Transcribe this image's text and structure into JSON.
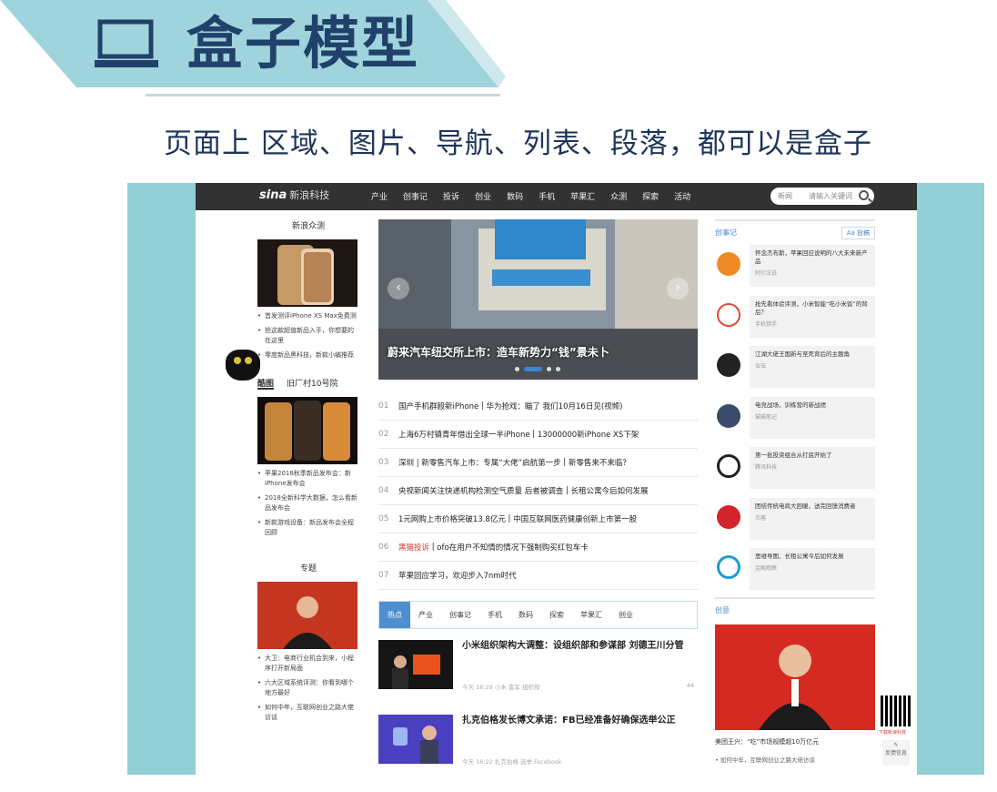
{
  "slide": {
    "title": "盒子模型",
    "subtitle": "页面上 区域、图片、导航、列表、段落，都可以是盒子",
    "colors": {
      "banner": "#9fd4dc",
      "title": "#21406a",
      "frame": "#93d0d6"
    }
  },
  "site": {
    "logo": "sina",
    "logo_sub": "新浪科技",
    "nav": [
      "产业",
      "创事记",
      "投诉",
      "创业",
      "数码",
      "手机",
      "苹果汇",
      "众测",
      "探索",
      "活动"
    ],
    "search": {
      "scope": "新闻",
      "placeholder": "请输入关键词"
    }
  },
  "left": {
    "sec1": "新浪众测",
    "news1": [
      "首发测评iPhone XS Max免费测",
      "抢这款超值新品入手，你想要的在这里",
      "零度新品黑科技，新款小编推荐"
    ],
    "sec2_tabs": [
      "酷图",
      "旧厂村10号院"
    ],
    "news2": [
      "苹果2018秋季新品发布会：新iPhone发布会",
      "2018全新科学大数据，怎么看新品发布会",
      "新款游戏设备：新品发布会全程回顾"
    ],
    "sec3": "专题",
    "news3": [
      "大卫：电商行业机会到来，小程序打开新局面",
      "六大区域系统评测：你看到哪个地方最好",
      "如何中年，互联网创业之路大佬访谈"
    ]
  },
  "center": {
    "hero_caption": "蔚来汽车纽交所上市：造车新势力“钱”景未卜",
    "top_news": [
      {
        "num": "01",
        "items": [
          "国产手机群殴新iPhone",
          "华为抢戏：瞄了 我们10月16日见(视频)"
        ]
      },
      {
        "num": "02",
        "items": [
          "上海6万村镇青年借出全球一半iPhone",
          "13000000新iPhone XS下架"
        ]
      },
      {
        "num": "03",
        "items": [
          "深圳 | 新零售汽车上市：专属“大佬”启航第一步",
          "新零售来不来临？"
        ]
      },
      {
        "num": "04",
        "items": [
          "央视新闻关注快递机构检测空气质量 后者被调查",
          "长租公寓今后如何发展"
        ]
      },
      {
        "num": "05",
        "items": [
          "1元网购上市价格突破13.8亿元",
          "中国互联网医药健康创新上市第一股"
        ]
      },
      {
        "num": "06",
        "hl": "黑猫投诉",
        "items": [
          "ofo在用户不知情的情况下强制购买红包车卡"
        ]
      },
      {
        "num": "07",
        "items": [
          "苹果回应学习，欢迎步入7nm时代"
        ]
      }
    ],
    "tabs": [
      "热点",
      "产业",
      "创事记",
      "手机",
      "数码",
      "探索",
      "苹果汇",
      "创业"
    ],
    "feed": [
      {
        "title": "小米组织架构大调整：设组织部和参谋部 刘德王川分管",
        "meta": "今天 16:29  小米 雷军 组织部",
        "count": "44"
      },
      {
        "title": "扎克伯格发长博文承诺：FB已经准备好确保选举公正",
        "meta": "今天 16:22  扎克伯格 选举 Facebook",
        "count": ""
      }
    ]
  },
  "right": {
    "head": "创事记",
    "head_tag": "Aa 投稿",
    "items": [
      {
        "title": "怀念杰布斯，苹果回应说明的八大未来新产品",
        "sub": "阿尔法说"
      },
      {
        "title": "抢先看体验评测，小米智能“吃小米饭”的背后？",
        "sub": "手机猎手"
      },
      {
        "title": "江湖大佬王国新与至死背后的主题角",
        "sub": "伍伍"
      },
      {
        "title": "电竞战场，训练营的新战绩",
        "sub": "猫猫笔记"
      },
      {
        "title": "第一批投资组合从打底开始了",
        "sub": "腾讯科技"
      },
      {
        "title": "团结传统电商大回暖，送完回馈消费者",
        "sub": "杰客"
      },
      {
        "title": "思维导图、长租公寓今后如何发展",
        "sub": "金融观察"
      }
    ],
    "head2": "创意",
    "photo_caption": "美团王兴：“吃”市场规模超10万亿元",
    "sub_line": "• 如何中年，互联网创业之路大佬访谈",
    "qr_label": "下载新浪科技",
    "edit_label": "反馈信息"
  }
}
